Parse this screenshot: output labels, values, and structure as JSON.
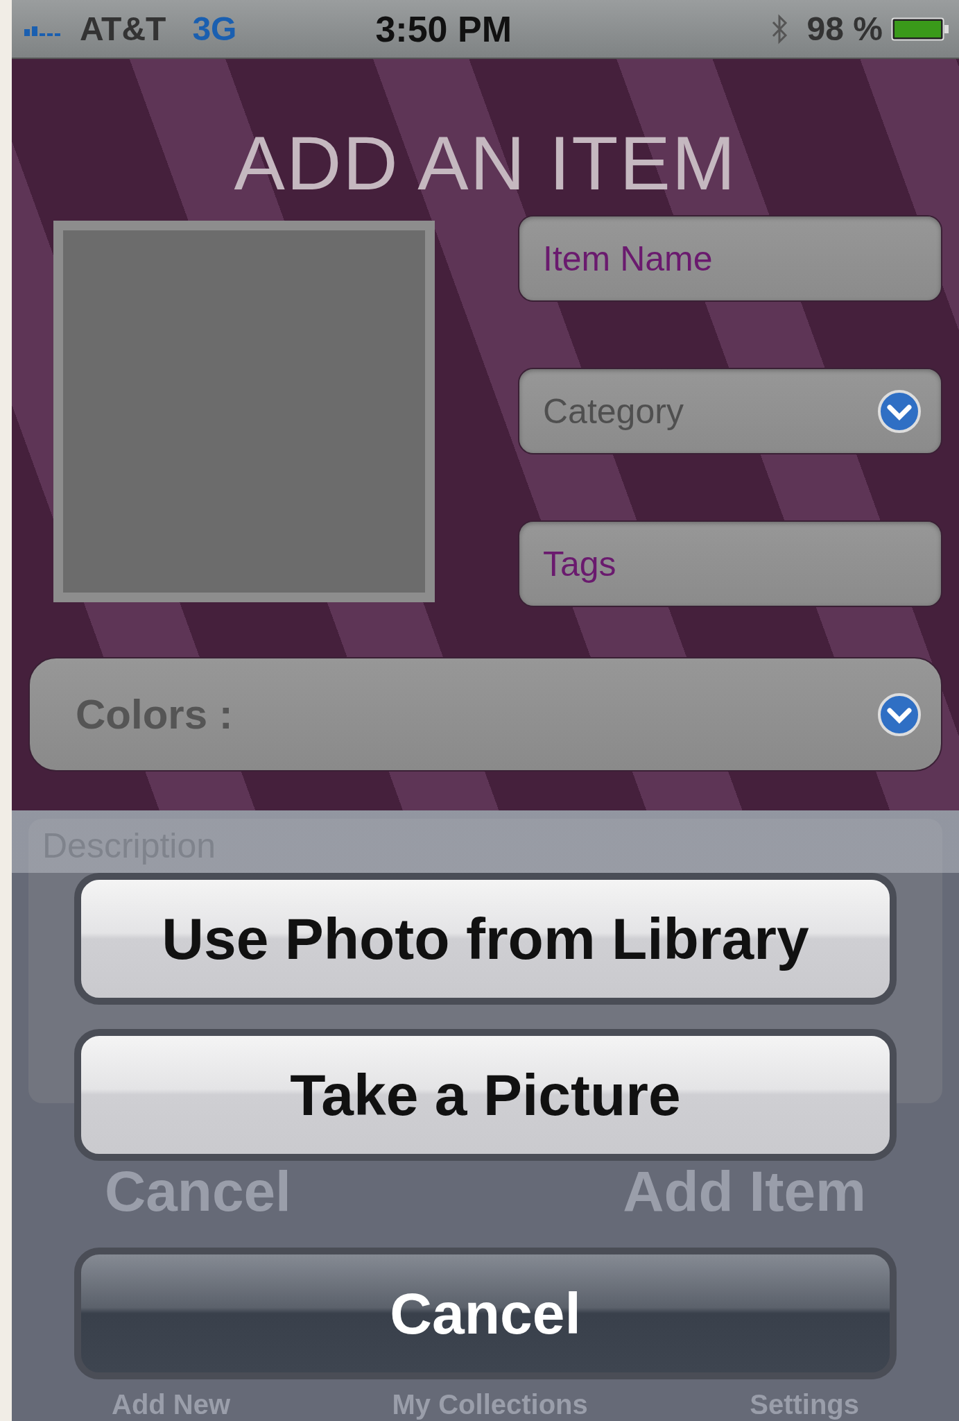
{
  "status_bar": {
    "carrier": "AT&T",
    "network": "3G",
    "time": "3:50 PM",
    "battery": "98 %"
  },
  "title": "ADD AN ITEM",
  "fields": [
    {
      "kind": "text",
      "placeholder": "Item Name"
    },
    {
      "kind": "dropdown",
      "placeholder": "Category"
    },
    {
      "kind": "text",
      "placeholder": "Tags"
    }
  ],
  "colors": {
    "label": "Colors :"
  },
  "description": {
    "placeholder": "Description"
  },
  "form_buttons": [
    "Cancel",
    "Add Item"
  ],
  "tab_bar": [
    {
      "label": "Add New"
    },
    {
      "label": "My Collections"
    },
    {
      "label": "Settings"
    }
  ],
  "action_sheet": [
    {
      "label": "Use Photo from Library",
      "kind": "default"
    },
    {
      "label": "Take a Picture",
      "kind": "default"
    },
    {
      "label": "Cancel",
      "kind": "cancel"
    }
  ]
}
